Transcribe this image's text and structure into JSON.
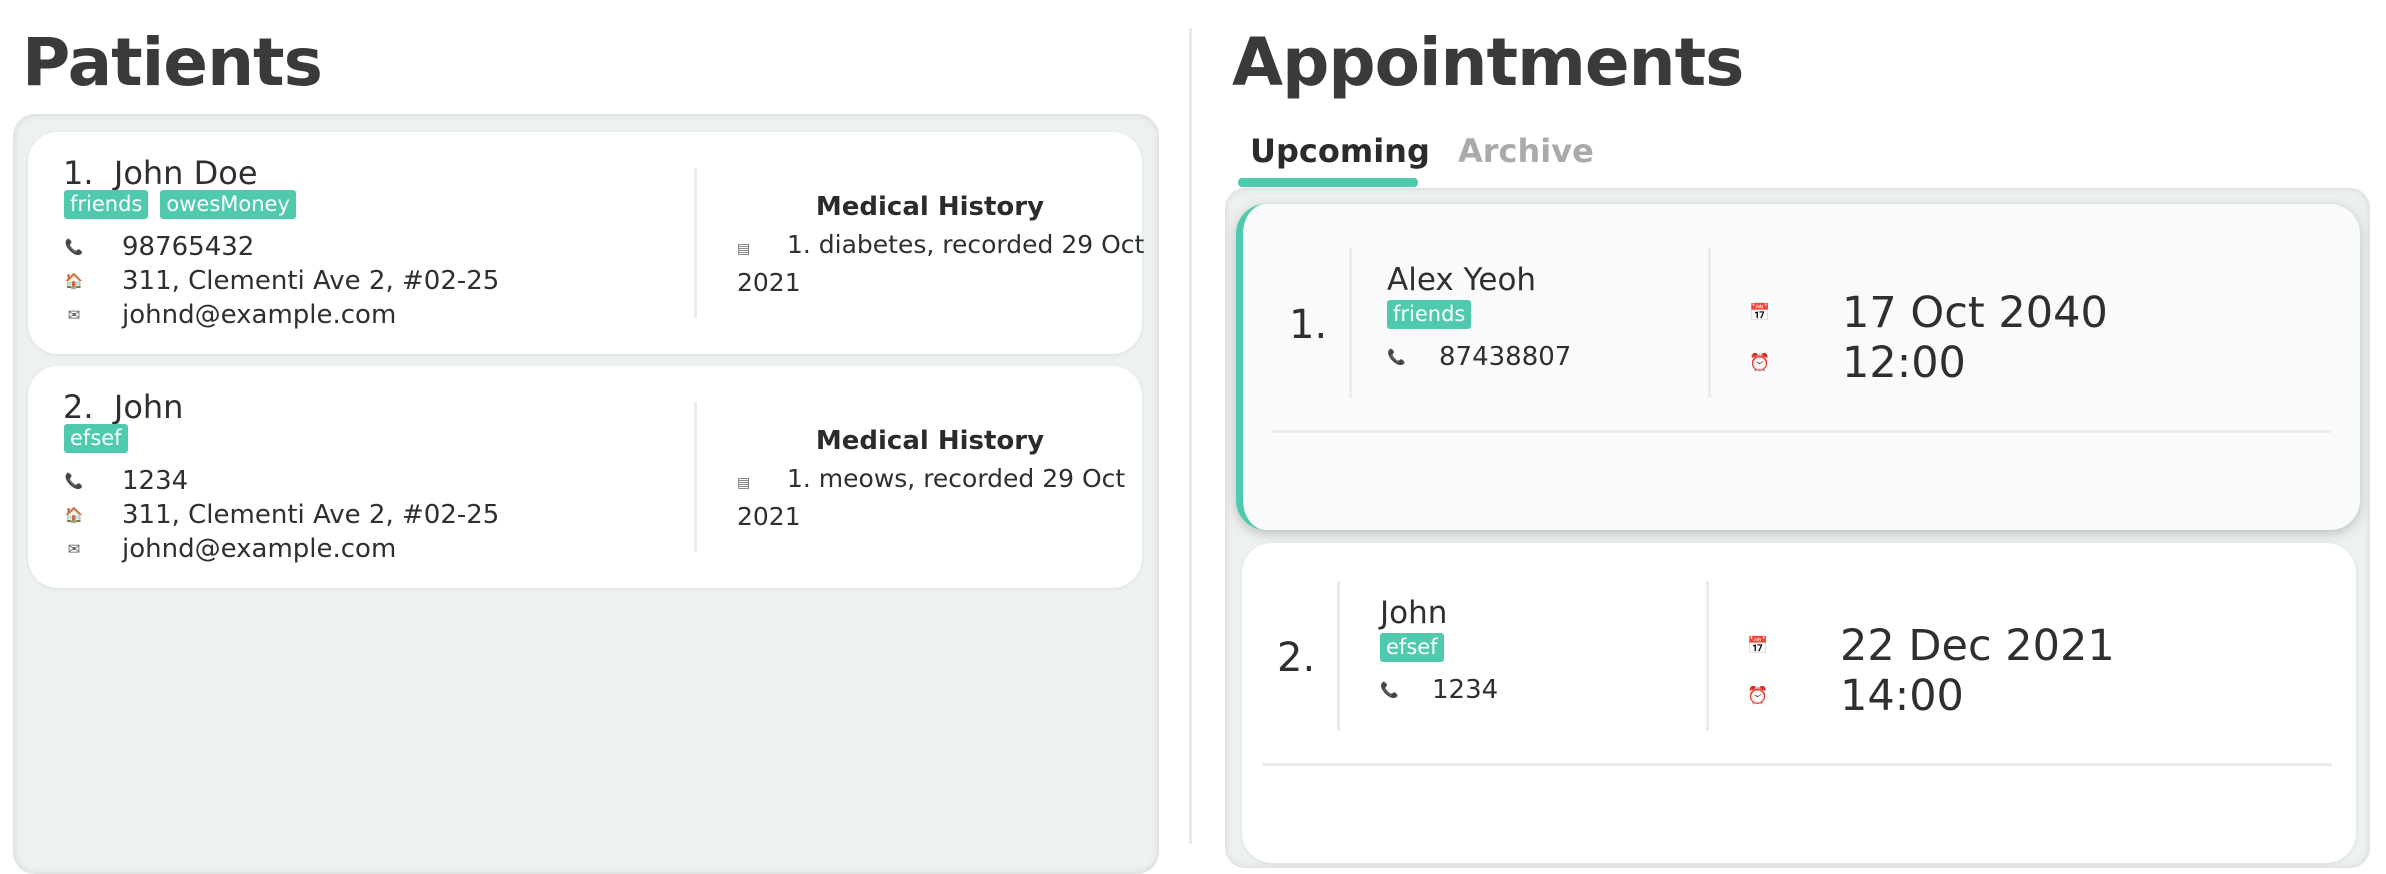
{
  "patients": {
    "title": "Patients",
    "list": [
      {
        "index": "1.",
        "name": "John Doe",
        "tags": [
          "friends",
          "owesMoney"
        ],
        "phone": "98765432",
        "address": "311, Clementi Ave 2, #02-25",
        "email": "johnd@example.com",
        "medical_history_title": "Medical History",
        "medical_history_line1": "1. diabetes, recorded 29 Oct",
        "medical_history_line2": "2021"
      },
      {
        "index": "2.",
        "name": "John",
        "tags": [
          "efsef"
        ],
        "phone": "1234",
        "address": "311, Clementi Ave 2, #02-25",
        "email": "johnd@example.com",
        "medical_history_title": "Medical History",
        "medical_history_line1": "1. meows, recorded 29 Oct",
        "medical_history_line2": "2021"
      }
    ]
  },
  "appointments": {
    "title": "Appointments",
    "tabs": [
      {
        "label": "Upcoming",
        "selected": true
      },
      {
        "label": "Archive",
        "selected": false
      }
    ],
    "list": [
      {
        "index": "1.",
        "name": "Alex Yeoh",
        "tags": [
          "friends"
        ],
        "phone": "87438807",
        "date": "17 Oct 2040",
        "time": "12:00"
      },
      {
        "index": "2.",
        "name": "John",
        "tags": [
          "efsef"
        ],
        "phone": "1234",
        "date": "22 Dec 2021",
        "time": "14:00"
      }
    ]
  },
  "icons": {
    "phone": "phone-icon",
    "address": "home-icon",
    "email": "email-icon",
    "medical": "medical-record-icon",
    "calendar": "calendar-icon",
    "clock": "alarm-clock-icon"
  },
  "colors": {
    "accent": "#4fcaae",
    "panel": "#edf2f1",
    "tab_inactive": "#aaaaaa"
  }
}
